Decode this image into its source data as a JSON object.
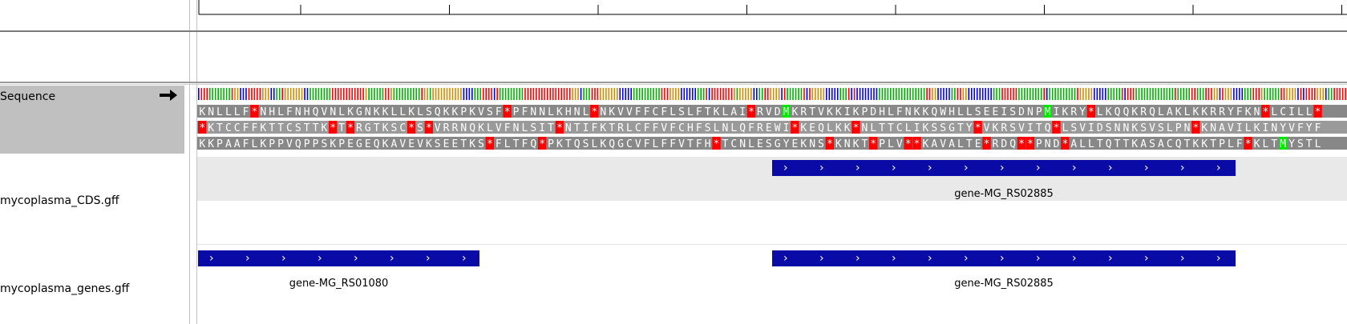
{
  "ruler": {
    "tick_count": 8
  },
  "tracks": {
    "sequence": {
      "label": "Sequence",
      "strand_arrow_icon": "right-arrow",
      "frames": [
        "KNLLLF*NHLFNHQVNLKGNKKLLKLSQKKPKVSF*PFNNLKHNL*NKVVFFCFLSLFTKLAI*RVDMKRTVKKIKPDHLFNKKQWHLLSEEISDNPMIKRY*LKQQKRQLAKLKKRRYFKN*LCILL*",
        "*KTCCFFKTTCSTTK*T*RGTKSC*S*VRRNQKLVFNLSIT*NTIFKTRLCFFVFCHFSLNLQFREWI*KEQLKK*NLTTCLIKSSGTY*VKRSVITQ*LSVIDSNNKSVSLPN*KNAVILKINYVFYF",
        "KKPAAFLKPPVQPPSKPEGEQKAVEVKSEETKS*FLTFQ*PKTQSLKQGCVFLFFVTFH*TCNLESGYEKNS*KNKT*PLV**KAVALTE*RDQ**PND*ALLTQTTKASACQTKKTPLF*KLTMYSTL"
      ]
    },
    "cds": {
      "label": "mycoplasma_CDS.gff",
      "features": [
        {
          "name": "gene-MG_RS02885",
          "start": 0.5,
          "end": 0.903
        }
      ]
    },
    "genes": {
      "label": "mycoplasma_genes.gff",
      "features": [
        {
          "name": "gene-MG_RS01080",
          "start": 0.001,
          "end": 0.246
        },
        {
          "name": "gene-MG_RS02885",
          "start": 0.5,
          "end": 0.903
        }
      ]
    }
  },
  "colors": {
    "stop_codon": "#ff0000",
    "start_codon": "#00e600",
    "gene_bar": "#0a0aa6",
    "name_panel": "#c0c0c0",
    "feature_background": "#e9e9e9",
    "base_A": "#00b000",
    "base_C": "#0000ee",
    "base_G": "#d18d00",
    "base_T": "#ff0000"
  }
}
